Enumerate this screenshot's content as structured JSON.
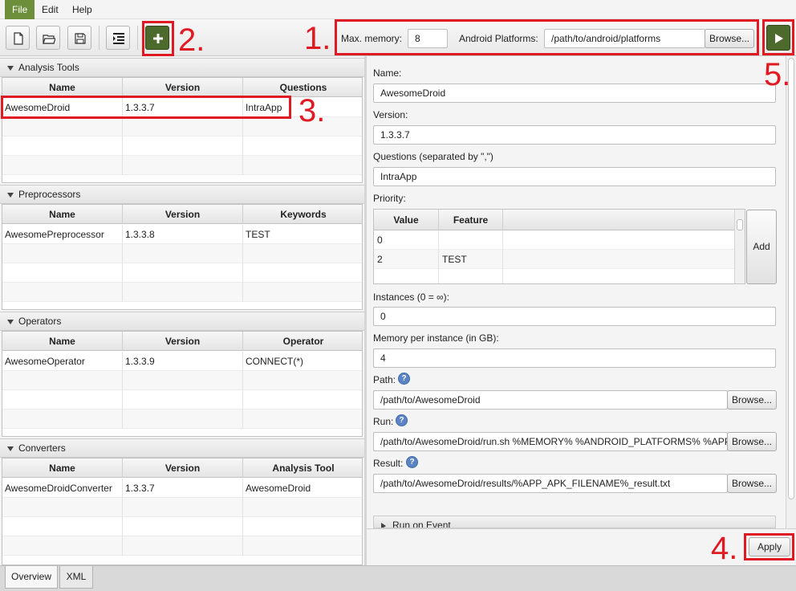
{
  "menu": {
    "items": [
      "File",
      "Edit",
      "Help"
    ]
  },
  "toolbar": {
    "buttons": [
      "new-file-icon",
      "open-folder-icon",
      "save-disk-icon",
      "indent-icon"
    ],
    "add_icon": "plus-icon",
    "max_memory_label": "Max. memory:",
    "max_memory_value": "8",
    "platforms_label": "Android Platforms:",
    "platforms_value": "/path/to/android/platforms",
    "browse_label": "Browse...",
    "run_icon": "play-icon"
  },
  "annotations": {
    "c1": "1.",
    "c2": "2.",
    "c3": "3.",
    "c4": "4.",
    "c5": "5."
  },
  "sections": [
    {
      "title": "Analysis Tools",
      "columns": [
        "Name",
        "Version",
        "Questions"
      ],
      "rows": [
        [
          "AwesomeDroid",
          "1.3.3.7",
          "IntraApp"
        ]
      ]
    },
    {
      "title": "Preprocessors",
      "columns": [
        "Name",
        "Version",
        "Keywords"
      ],
      "rows": [
        [
          "AwesomePreprocessor",
          "1.3.3.8",
          "TEST"
        ]
      ]
    },
    {
      "title": "Operators",
      "columns": [
        "Name",
        "Version",
        "Operator"
      ],
      "rows": [
        [
          "AwesomeOperator",
          "1.3.3.9",
          "CONNECT(*)"
        ]
      ]
    },
    {
      "title": "Converters",
      "columns": [
        "Name",
        "Version",
        "Analysis Tool"
      ],
      "rows": [
        [
          "AwesomeDroidConverter",
          "1.3.3.7",
          "AwesomeDroid"
        ]
      ]
    }
  ],
  "form": {
    "name_label": "Name:",
    "name_value": "AwesomeDroid",
    "version_label": "Version:",
    "version_value": "1.3.3.7",
    "questions_label": "Questions (separated by \",\")",
    "questions_value": "IntraApp",
    "priority_label": "Priority:",
    "priority_columns": [
      "Value",
      "Feature"
    ],
    "priority_rows": [
      [
        "0",
        ""
      ],
      [
        "2",
        "TEST"
      ],
      [
        "",
        ""
      ]
    ],
    "add_label": "Add",
    "instances_label": "Instances (0 = ∞):",
    "instances_value": "0",
    "memory_label": "Memory per instance (in GB):",
    "memory_value": "4",
    "path_label": "Path:",
    "path_value": "/path/to/AwesomeDroid",
    "run_label": "Run:",
    "run_value": "/path/to/AwesomeDroid/run.sh %MEMORY% %ANDROID_PLATFORMS% %APP_",
    "result_label": "Result:",
    "result_value": "/path/to/AwesomeDroid/results/%APP_APK_FILENAME%_result.txt",
    "browse_label": "Browse...",
    "help_glyph": "?",
    "run_on_event_label": "Run on Event",
    "apply_label": "Apply"
  },
  "tabs": [
    "Overview",
    "XML"
  ],
  "colors": {
    "accent": "#4b6a2c",
    "annotation": "#e01a22",
    "menu_active": "#6d8f3c"
  }
}
